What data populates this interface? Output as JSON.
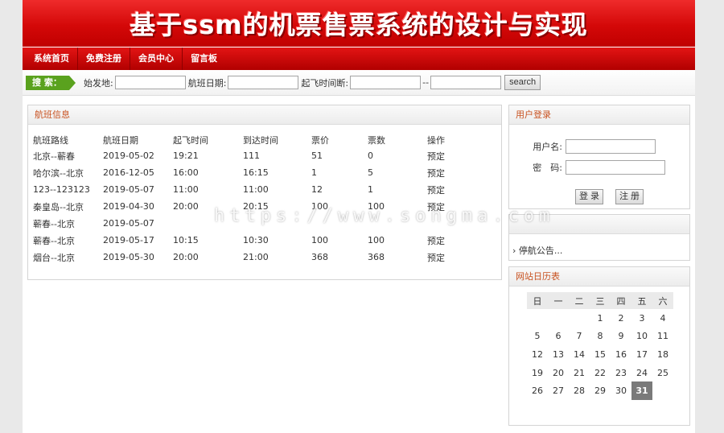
{
  "banner": {
    "title": "基于ssm的机票售票系统的设计与实现"
  },
  "nav": {
    "items": [
      "系统首页",
      "免费注册",
      "会员中心",
      "留言板"
    ]
  },
  "search": {
    "tag": "搜 索：",
    "departure_label": "始发地:",
    "date_label": "航班日期:",
    "time_label": "起飞时间断:",
    "separator": "--",
    "button": "search"
  },
  "flights": {
    "title": "航班信息",
    "columns": [
      "航班路线",
      "航班日期",
      "起飞时间",
      "到达时间",
      "票价",
      "票数",
      "操作"
    ],
    "rows": [
      [
        "北京--蕲春",
        "2019-05-02",
        "19:21",
        "111",
        "51",
        "0",
        "预定"
      ],
      [
        "哈尔滨--北京",
        "2016-12-05",
        "16:00",
        "16:15",
        "1",
        "5",
        "预定"
      ],
      [
        "123--123123",
        "2019-05-07",
        "11:00",
        "11:00",
        "12",
        "1",
        "预定"
      ],
      [
        "秦皇岛--北京",
        "2019-04-30",
        "20:00",
        "20:15",
        "100",
        "100",
        "预定"
      ],
      [
        "蕲春--北京",
        "2019-05-07",
        "",
        "",
        "",
        "",
        ""
      ],
      [
        "蕲春--北京",
        "2019-05-17",
        "10:15",
        "10:30",
        "100",
        "100",
        "预定"
      ],
      [
        "烟台--北京",
        "2019-05-30",
        "20:00",
        "21:00",
        "368",
        "368",
        "预定"
      ]
    ]
  },
  "login": {
    "title": "用户登录",
    "username_label": "用户名:",
    "password_label": "密　码:",
    "login_button": "登 录",
    "register_button": "注 册"
  },
  "notice": {
    "item": "停航公告..."
  },
  "calendar": {
    "title": "网站日历表",
    "weekdays": [
      "日",
      "一",
      "二",
      "三",
      "四",
      "五",
      "六"
    ],
    "weeks": [
      [
        "",
        "",
        "",
        "1",
        "2",
        "3",
        "4"
      ],
      [
        "5",
        "6",
        "7",
        "8",
        "9",
        "10",
        "11"
      ],
      [
        "12",
        "13",
        "14",
        "15",
        "16",
        "17",
        "18"
      ],
      [
        "19",
        "20",
        "21",
        "22",
        "23",
        "24",
        "25"
      ],
      [
        "26",
        "27",
        "28",
        "29",
        "30",
        "31",
        ""
      ]
    ],
    "today": "31"
  },
  "watermark": "https://www.songma.com"
}
